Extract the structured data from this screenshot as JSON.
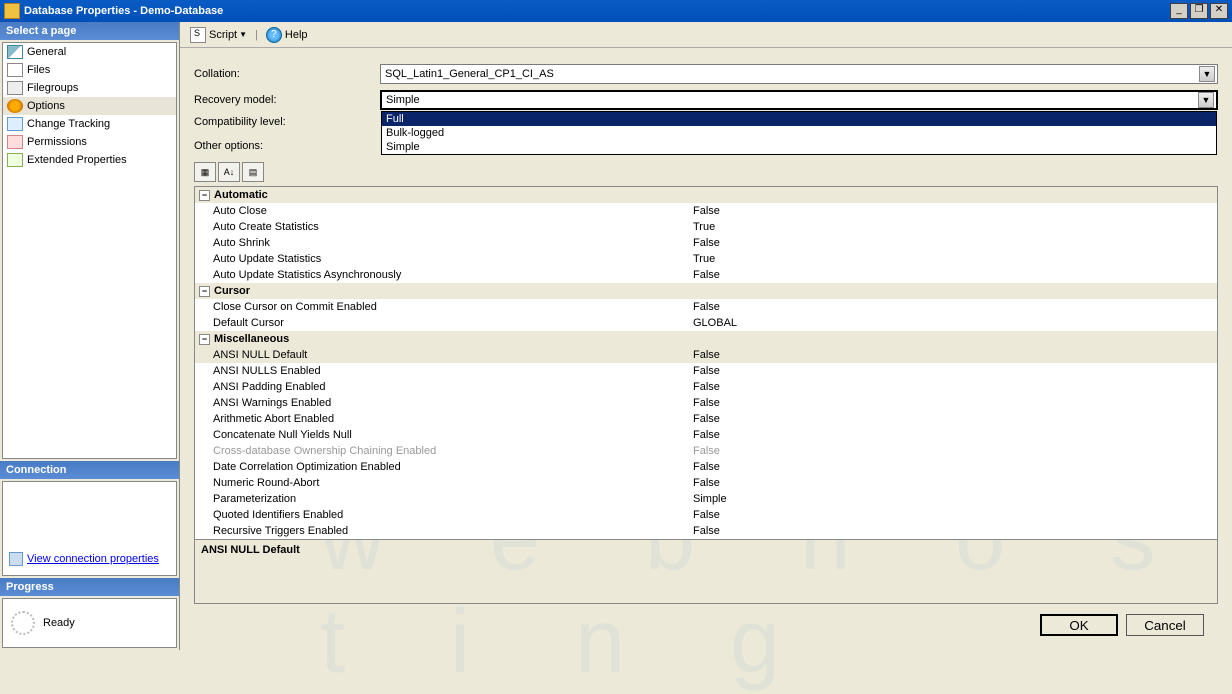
{
  "window": {
    "title": "Database Properties - Demo-Database"
  },
  "sidebar": {
    "pages_header": "Select a page",
    "pages": [
      {
        "label": "General",
        "icon": "icon-general"
      },
      {
        "label": "Files",
        "icon": "icon-files"
      },
      {
        "label": "Filegroups",
        "icon": "icon-filegroups"
      },
      {
        "label": "Options",
        "icon": "icon-options",
        "selected": true
      },
      {
        "label": "Change Tracking",
        "icon": "icon-tracking"
      },
      {
        "label": "Permissions",
        "icon": "icon-permissions"
      },
      {
        "label": "Extended Properties",
        "icon": "icon-extended"
      }
    ],
    "connection_header": "Connection",
    "connection_link": "View connection properties",
    "progress_header": "Progress",
    "progress_status": "Ready"
  },
  "toolbar": {
    "script": "Script",
    "help": "Help"
  },
  "form": {
    "collation_label": "Collation:",
    "collation_value": "SQL_Latin1_General_CP1_CI_AS",
    "recovery_label": "Recovery model:",
    "recovery_value": "Simple",
    "recovery_options": [
      "Full",
      "Bulk-logged",
      "Simple"
    ],
    "recovery_highlighted": "Full",
    "compat_label": "Compatibility level:",
    "other_label": "Other options:"
  },
  "grid": {
    "categories": [
      {
        "name": "Automatic",
        "rows": [
          {
            "name": "Auto Close",
            "value": "False"
          },
          {
            "name": "Auto Create Statistics",
            "value": "True"
          },
          {
            "name": "Auto Shrink",
            "value": "False"
          },
          {
            "name": "Auto Update Statistics",
            "value": "True"
          },
          {
            "name": "Auto Update Statistics Asynchronously",
            "value": "False"
          }
        ]
      },
      {
        "name": "Cursor",
        "rows": [
          {
            "name": "Close Cursor on Commit Enabled",
            "value": "False"
          },
          {
            "name": "Default Cursor",
            "value": "GLOBAL"
          }
        ]
      },
      {
        "name": "Miscellaneous",
        "rows": [
          {
            "name": "ANSI NULL Default",
            "value": "False",
            "selected": true
          },
          {
            "name": "ANSI NULLS Enabled",
            "value": "False"
          },
          {
            "name": "ANSI Padding Enabled",
            "value": "False"
          },
          {
            "name": "ANSI Warnings Enabled",
            "value": "False"
          },
          {
            "name": "Arithmetic Abort Enabled",
            "value": "False"
          },
          {
            "name": "Concatenate Null Yields Null",
            "value": "False"
          },
          {
            "name": "Cross-database Ownership Chaining Enabled",
            "value": "False",
            "disabled": true
          },
          {
            "name": "Date Correlation Optimization Enabled",
            "value": "False"
          },
          {
            "name": "Numeric Round-Abort",
            "value": "False"
          },
          {
            "name": "Parameterization",
            "value": "Simple"
          },
          {
            "name": "Quoted Identifiers Enabled",
            "value": "False"
          },
          {
            "name": "Recursive Triggers Enabled",
            "value": "False"
          }
        ]
      }
    ],
    "desc_title": "ANSI NULL Default"
  },
  "buttons": {
    "ok": "OK",
    "cancel": "Cancel"
  }
}
